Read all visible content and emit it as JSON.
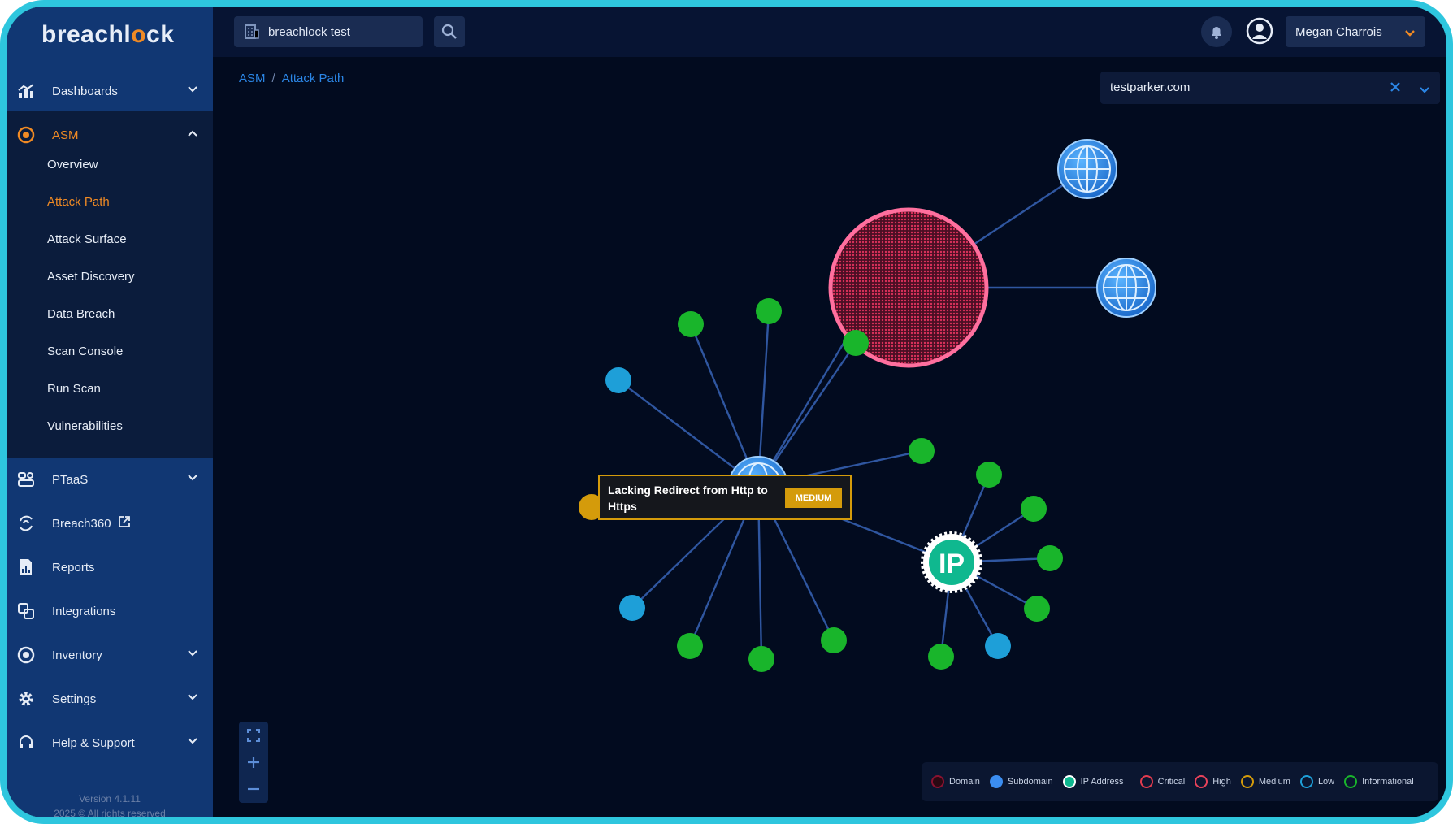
{
  "app": {
    "logo_prefix": "breachl",
    "logo_accent": "o",
    "logo_suffix": "ck",
    "accent_color": "#f08a24",
    "frame_color": "#2ec6de"
  },
  "sidebar": {
    "dashboards": "Dashboards",
    "asm": "ASM",
    "asm_items": [
      "Overview",
      "Attack Path",
      "Attack Surface",
      "Asset Discovery",
      "Data Breach",
      "Scan Console",
      "Run Scan",
      "Vulnerabilities"
    ],
    "active_item": "Attack Path",
    "ptaas": "PTaaS",
    "breach360": "Breach360",
    "reports": "Reports",
    "integrations": "Integrations",
    "inventory": "Inventory",
    "settings": "Settings",
    "help": "Help & Support",
    "version": "Version 4.1.11",
    "copyright": "2025 © All rights reserved"
  },
  "topbar": {
    "search_value": "breachlock test",
    "user_name": "Megan Charrois"
  },
  "breadcrumb": {
    "root": "ASM",
    "current": "Attack Path"
  },
  "domain_filter": {
    "value": "testparker.com"
  },
  "graph": {
    "ip_label": "IP",
    "tooltip_text": "Lacking Redirect from Http to Https",
    "tooltip_badge": "MEDIUM",
    "severity_colors": {
      "critical": "#e23b4e",
      "high": "#e8425a",
      "medium": "#d49b0b",
      "low": "#1e9fd8",
      "informational": "#19b52b"
    }
  },
  "legend": [
    "Domain",
    "Subdomain",
    "IP Address",
    "Critical",
    "High",
    "Medium",
    "Low",
    "Informational"
  ]
}
